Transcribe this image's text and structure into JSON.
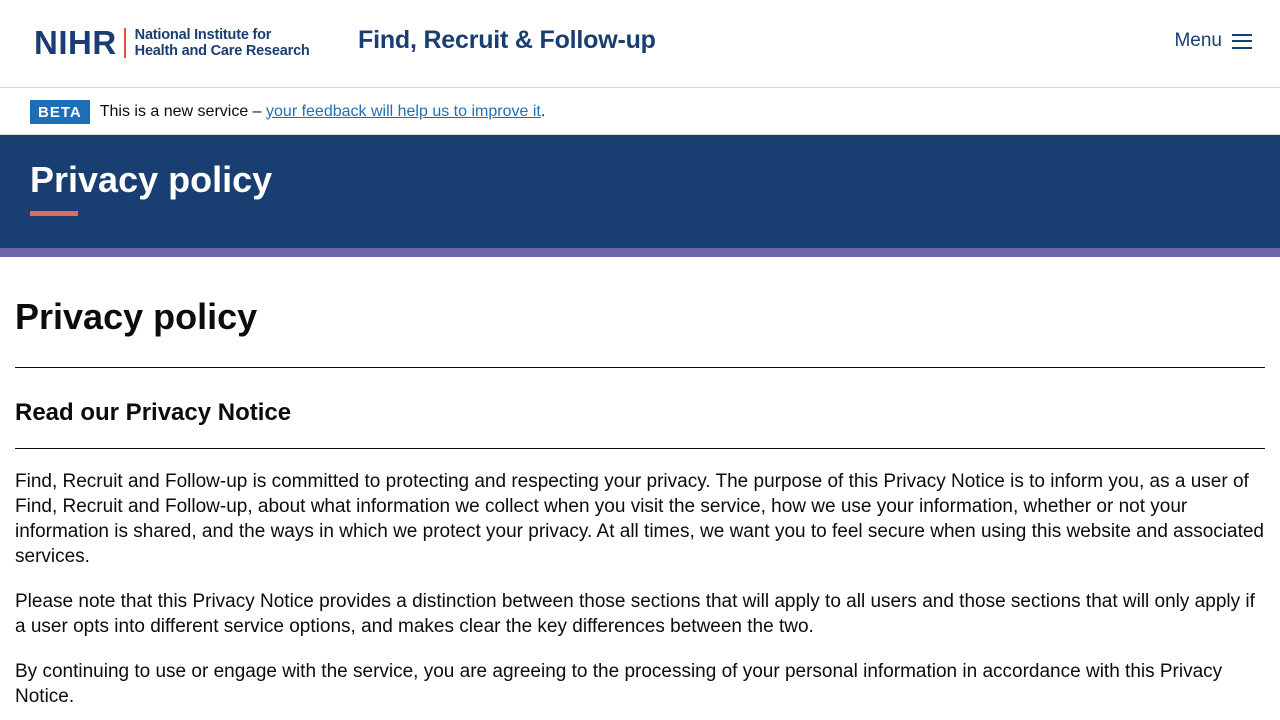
{
  "header": {
    "logo_mark": "NIHR",
    "logo_line1": "National Institute for",
    "logo_line2": "Health and Care Research",
    "service_name": "Find, Recruit & Follow-up",
    "menu_label": "Menu"
  },
  "beta": {
    "tag": "BETA",
    "text": "This is a new service – ",
    "link": "your feedback will help us to improve it",
    "suffix": "."
  },
  "hero": {
    "title": "Privacy policy"
  },
  "main": {
    "title": "Privacy policy",
    "section_title": "Read our Privacy Notice",
    "paragraphs": [
      "Find, Recruit and Follow-up is committed to protecting and respecting your privacy. The purpose of this Privacy Notice is to inform you, as a user of Find, Recruit and Follow-up, about what information we collect when you visit the service, how we use your information, whether or not your information is shared, and the ways in which we protect your privacy. At all times, we want you to feel secure when using this website and associated services.",
      "Please note that this Privacy Notice provides a distinction between those sections that will apply to all users and those sections that will only apply if a user opts into different service options, and makes clear the key differences between the two.",
      "By continuing to use or engage with the service, you are agreeing to the processing of your personal information in accordance with this Privacy Notice."
    ]
  },
  "colors": {
    "brand_navy": "#193e72",
    "accent_red": "#e56b61",
    "stripe_purple": "#6f63ac",
    "link_blue": "#1d70b8"
  }
}
